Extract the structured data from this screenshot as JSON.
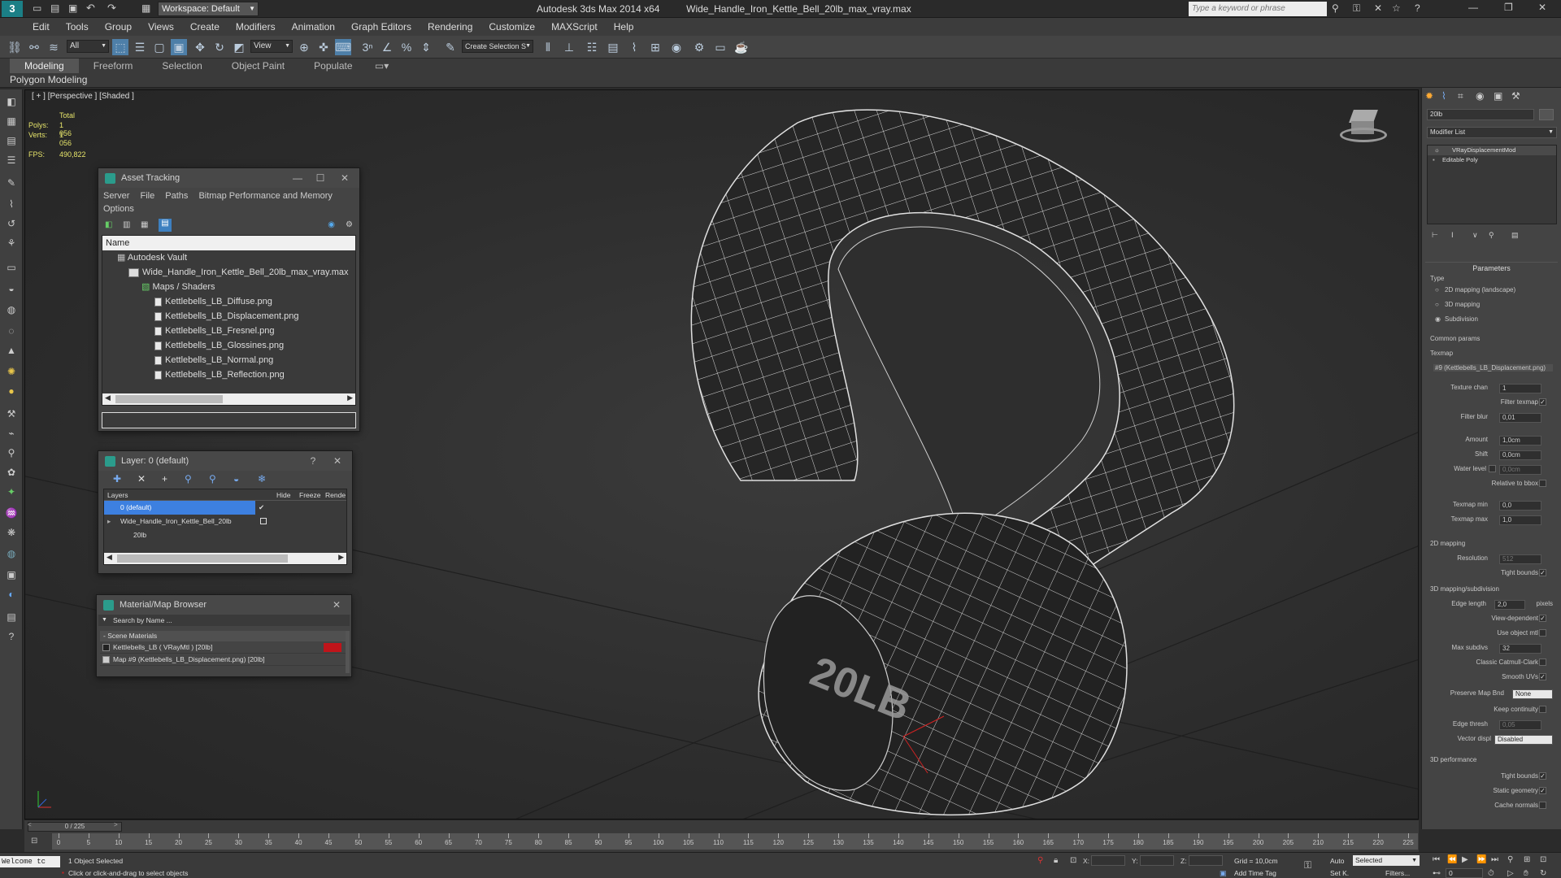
{
  "title_bar": {
    "workspace": "Workspace: Default",
    "app_title": "Autodesk 3ds Max  2014 x64",
    "file_title": "Wide_Handle_Iron_Kettle_Bell_20lb_max_vray.max",
    "search_placeholder": "Type a keyword or phrase"
  },
  "menu": [
    "Edit",
    "Tools",
    "Group",
    "Views",
    "Create",
    "Modifiers",
    "Animation",
    "Graph Editors",
    "Rendering",
    "Customize",
    "MAXScript",
    "Help"
  ],
  "toolbar": {
    "filter": "All",
    "view": "View",
    "selection_set": "Create Selection S"
  },
  "ribbon": {
    "tabs": [
      "Modeling",
      "Freeform",
      "Selection",
      "Object Paint",
      "Populate"
    ],
    "active_tab": "Modeling",
    "sub_label": "Polygon Modeling"
  },
  "viewport": {
    "label": "[ + ] [Perspective ] [Shaded ]",
    "total": "Total",
    "polys_label": "Polys:",
    "polys_value": "1 056",
    "verts_label": "Verts:",
    "verts_value": "1 056",
    "fps_label": "FPS:",
    "fps_value": "490,822",
    "model_text": "20LB"
  },
  "asset_tracking": {
    "title": "Asset Tracking",
    "menu": [
      "Server",
      "File",
      "Paths",
      "Bitmap Performance and Memory"
    ],
    "menu2": "Options",
    "column": "Name",
    "vault": "Autodesk Vault",
    "file": "Wide_Handle_Iron_Kettle_Bell_20lb_max_vray.max",
    "folder": "Maps / Shaders",
    "maps": [
      "Kettlebells_LB_Diffuse.png",
      "Kettlebells_LB_Displacement.png",
      "Kettlebells_LB_Fresnel.png",
      "Kettlebells_LB_Glossines.png",
      "Kettlebells_LB_Normal.png",
      "Kettlebells_LB_Reflection.png"
    ]
  },
  "layer_window": {
    "title": "Layer: 0 (default)",
    "help": "?",
    "columns": [
      "Layers",
      "Hide",
      "Freeze",
      "Rende"
    ],
    "layers": [
      "0 (default)",
      "Wide_Handle_Iron_Kettle_Bell_20lb",
      "20lb"
    ]
  },
  "material_browser": {
    "title": "Material/Map Browser",
    "search_placeholder": "Search by Name ...",
    "section": "- Scene Materials",
    "items": [
      "Kettlebells_LB ( VRayMtl ) [20lb]",
      "Map #9 (Kettlebells_LB_Displacement.png) [20lb]"
    ]
  },
  "command_panel": {
    "object_name": "20lb",
    "modifier_list": "Modifier List",
    "stack": [
      "VRayDisplacementMod",
      "Editable Poly"
    ],
    "parameters_title": "Parameters",
    "type_label": "Type",
    "type_options": [
      "2D mapping (landscape)",
      "3D mapping",
      "Subdivision"
    ],
    "common_params": "Common params",
    "texmap_label": "Texmap",
    "texmap_value": "#9 (Kettlebells_LB_Displacement.png)",
    "texture_chan_label": "Texture chan",
    "texture_chan_value": "1",
    "filter_texmap_label": "Filter texmap",
    "filter_blur_label": "Filter blur",
    "filter_blur_value": "0,01",
    "amount_label": "Amount",
    "amount_value": "1,0cm",
    "shift_label": "Shift",
    "shift_value": "0,0cm",
    "water_level_label": "Water level",
    "water_level_value": "0,0cm",
    "relative_bbox_label": "Relative to bbox",
    "texmap_min_label": "Texmap min",
    "texmap_min_value": "0,0",
    "texmap_max_label": "Texmap max",
    "texmap_max_value": "1,0",
    "mapping2d_title": "2D mapping",
    "resolution_label": "Resolution",
    "resolution_value": "512",
    "tight_bounds_label": "Tight bounds",
    "mapping3d_title": "3D mapping/subdivision",
    "edge_length_label": "Edge length",
    "edge_length_value": "2,0",
    "pixels_label": "pixels",
    "view_dependent_label": "View-dependent",
    "use_object_mtl_label": "Use object mtl",
    "max_subdivs_label": "Max subdivs",
    "max_subdivs_value": "32",
    "classic_cc_label": "Classic Catmull-Clark",
    "smooth_uvs_label": "Smooth UVs",
    "preserve_map_label": "Preserve Map Bnd",
    "preserve_map_value": "None",
    "keep_continuity_label": "Keep continuity",
    "edge_thresh_label": "Edge thresh",
    "edge_thresh_value": "0,05",
    "vector_displ_label": "Vector displ",
    "vector_displ_value": "Disabled",
    "perf_title": "3D performance",
    "perf_tight_label": "Tight bounds",
    "static_geom_label": "Static geometry",
    "cache_normals_label": "Cache normals"
  },
  "timeline": {
    "frame_counter": "0 / 225",
    "ticks": [
      "0",
      "5",
      "10",
      "15",
      "20",
      "25",
      "30",
      "35",
      "40",
      "45",
      "50",
      "55",
      "60",
      "65",
      "70",
      "75",
      "80",
      "85",
      "90",
      "95",
      "100",
      "105",
      "110",
      "115",
      "120",
      "125",
      "130",
      "135",
      "140",
      "145",
      "150",
      "155",
      "160",
      "165",
      "170",
      "175",
      "180",
      "185",
      "190",
      "195",
      "200",
      "205",
      "210",
      "215",
      "220",
      "225"
    ]
  },
  "status": {
    "welcome": "Welcome tc",
    "selected": "1 Object Selected",
    "hint": "Click or click-and-drag to select objects",
    "x_label": "X:",
    "y_label": "Y:",
    "z_label": "Z:",
    "grid": "Grid = 10,0cm",
    "add_time_tag": "Add Time Tag",
    "auto": "Auto",
    "selected_mode": "Selected",
    "set_key": "Set K.",
    "filters": "Filters...",
    "frame": "0"
  }
}
